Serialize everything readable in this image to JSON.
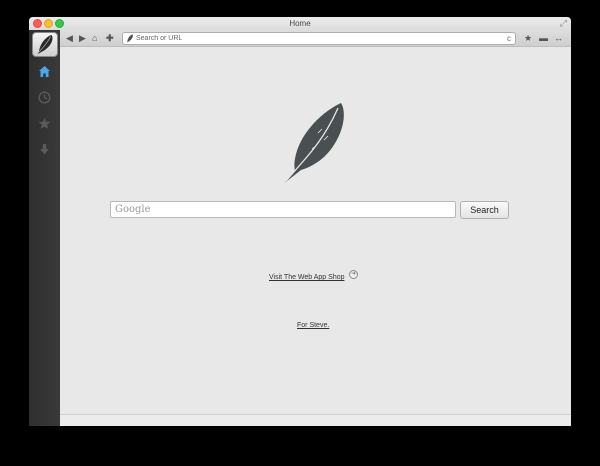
{
  "window": {
    "title": "Home"
  },
  "titlebar": {
    "fullscreen_icon": "fullscreen-arrows-icon"
  },
  "toolbar": {
    "back_icon": "back-arrow-icon",
    "forward_icon": "forward-arrow-icon",
    "home_icon": "home-icon",
    "add_icon": "add-icon",
    "url_placeholder": "Search or URL",
    "reload_glyph": "c",
    "bookmark_icon": "star-icon",
    "minimize_icon": "minus-icon",
    "resize_icon": "resize-arrows-icon"
  },
  "sidebar": {
    "items": [
      {
        "name": "home",
        "icon": "home-icon",
        "active": true,
        "color": "#4aa8e8"
      },
      {
        "name": "history",
        "icon": "clock-icon",
        "active": false,
        "color": "#5a5a5a"
      },
      {
        "name": "bookmarks",
        "icon": "star-icon",
        "active": false,
        "color": "#5a5a5a"
      },
      {
        "name": "downloads",
        "icon": "download-arrow-icon",
        "active": false,
        "color": "#5a5a5a"
      }
    ],
    "settings_icon": "gear-icon"
  },
  "main": {
    "search_placeholder": "Google",
    "search_button": "Search",
    "shop_link": "Visit The Web App Shop",
    "dedication_link": "For Steve."
  },
  "colors": {
    "feather": "#4a5052",
    "content_bg": "#e8e8e8",
    "sidebar_bg": "#333333"
  }
}
